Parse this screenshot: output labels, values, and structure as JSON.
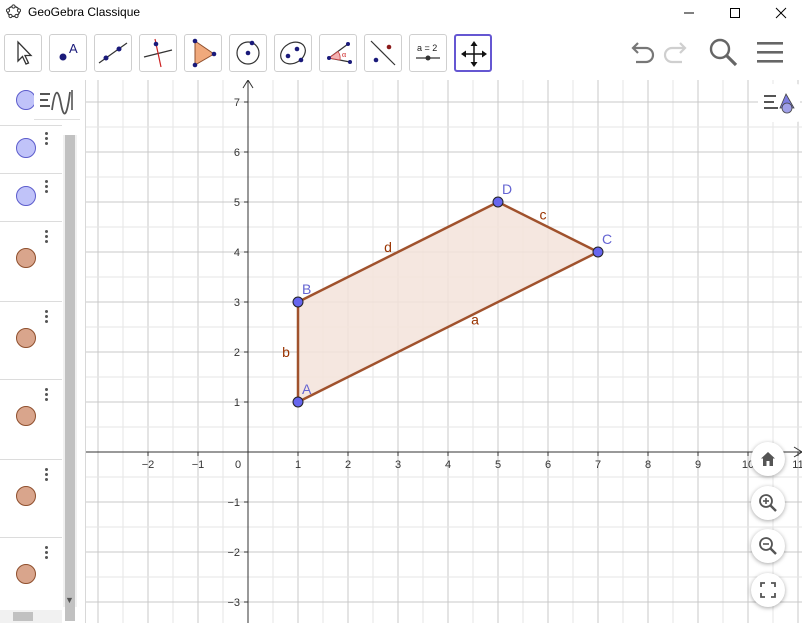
{
  "window": {
    "title": "GeoGebra Classique"
  },
  "toolbar": {
    "tools": [
      {
        "name": "move-tool",
        "icon": "arrow-pointer-icon"
      },
      {
        "name": "point-tool",
        "icon": "point-icon",
        "label": "A"
      },
      {
        "name": "line-tool",
        "icon": "line-through-two-points-icon"
      },
      {
        "name": "perpendicular-line-tool",
        "icon": "perpendicular-line-icon"
      },
      {
        "name": "polygon-tool",
        "icon": "polygon-icon"
      },
      {
        "name": "circle-center-point-tool",
        "icon": "circle-center-point-icon"
      },
      {
        "name": "ellipse-tool",
        "icon": "ellipse-icon"
      },
      {
        "name": "angle-tool",
        "icon": "angle-icon",
        "label": "α"
      },
      {
        "name": "reflect-tool",
        "icon": "reflect-about-line-icon"
      },
      {
        "name": "slider-tool",
        "icon": "slider-icon",
        "label": "a = 2"
      },
      {
        "name": "move-graphics-view-tool",
        "icon": "move-graphics-view-icon"
      }
    ]
  },
  "algebra": {
    "rows": [
      {
        "color": "#c0c3f9",
        "border": "#5c5ccc"
      },
      {
        "color": "#c0c3f9",
        "border": "#5c5ccc"
      },
      {
        "color": "#c0c3f9",
        "border": "#5c5ccc"
      },
      {
        "color": "#d9a58c",
        "border": "#8f4f2d"
      },
      {
        "color": "#d9a58c",
        "border": "#8f4f2d"
      },
      {
        "color": "#d9a58c",
        "border": "#8f4f2d"
      },
      {
        "color": "#d9a58c",
        "border": "#8f4f2d"
      },
      {
        "color": "#d9a58c",
        "border": "#8f4f2d"
      }
    ]
  },
  "graphics": {
    "x_ticks": [
      "−2",
      "−1",
      "0",
      "1",
      "2",
      "3",
      "4",
      "5",
      "6",
      "7",
      "8",
      "9",
      "10",
      "11"
    ],
    "y_ticks": [
      "7",
      "6",
      "5",
      "4",
      "3",
      "2",
      "1",
      "−1",
      "−2",
      "−3"
    ],
    "points": [
      {
        "label": "A",
        "x": 1,
        "y": 1
      },
      {
        "label": "B",
        "x": 1,
        "y": 3
      },
      {
        "label": "C",
        "x": 7,
        "y": 4
      },
      {
        "label": "D",
        "x": 5,
        "y": 5
      }
    ],
    "segments": [
      {
        "label": "a",
        "from": "A",
        "to": "C"
      },
      {
        "label": "b",
        "from": "A",
        "to": "B"
      },
      {
        "label": "c",
        "from": "C",
        "to": "D"
      },
      {
        "label": "d",
        "from": "B",
        "to": "D"
      }
    ],
    "colors": {
      "point_fill": "#6666ee",
      "point_label": "#6464d2",
      "segment": "#a0522d",
      "polygon_fill": "#f3e3da",
      "segment_label": "#993300"
    }
  }
}
